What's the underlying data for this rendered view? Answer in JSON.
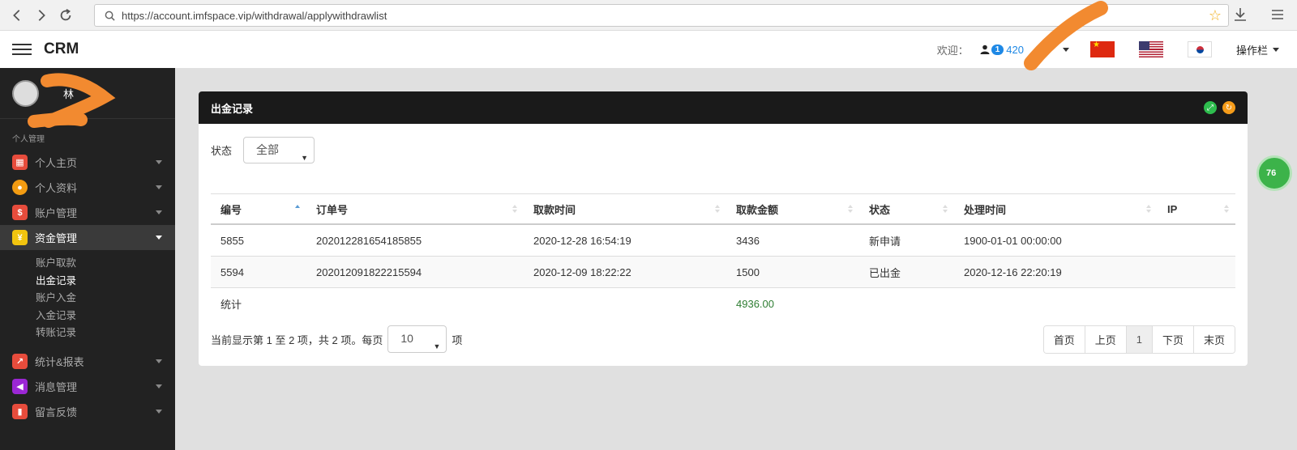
{
  "browser": {
    "url": "https://account.imfspace.vip/withdrawal/applywithdrawlist"
  },
  "header": {
    "brand": "CRM",
    "welcome": "欢迎：",
    "notify_count": "1",
    "user_id_partial": "420",
    "operations": "操作栏"
  },
  "sidebar": {
    "profile_name": "林",
    "section_label": "个人管理",
    "items": [
      {
        "label": "个人主页",
        "icon_color": "#e74c3c",
        "icon": "grid-icon"
      },
      {
        "label": "个人资料",
        "icon_color": "#f39c12",
        "icon": "person-icon"
      },
      {
        "label": "账户管理",
        "icon_color": "#e74c3c",
        "icon": "dollar-icon"
      },
      {
        "label": "资金管理",
        "icon_color": "#f1c40f",
        "icon": "yen-icon"
      },
      {
        "label": "统计&报表",
        "icon_color": "#e74c3c",
        "icon": "chart-icon"
      },
      {
        "label": "消息管理",
        "icon_color": "#9b27d4",
        "icon": "megaphone-icon"
      },
      {
        "label": "留言反馈",
        "icon_color": "#e74c3c",
        "icon": "feedback-icon"
      }
    ],
    "submenu": [
      "账户取款",
      "出金记录",
      "账户入金",
      "入金记录",
      "转账记录"
    ],
    "current_sub": "出金记录"
  },
  "panel": {
    "title": "出金记录",
    "filter_label": "状态",
    "filter_value": "全部"
  },
  "table": {
    "columns": [
      "编号",
      "订单号",
      "取款时间",
      "取款金额",
      "状态",
      "处理时间",
      "IP"
    ],
    "rows": [
      [
        "5855",
        "202012281654185855",
        "2020-12-28 16:54:19",
        "3436",
        "新申请",
        "1900-01-01 00:00:00",
        ""
      ],
      [
        "5594",
        "202012091822215594",
        "2020-12-09 18:22:22",
        "1500",
        "已出金",
        "2020-12-16 22:20:19",
        ""
      ]
    ],
    "total_label": "统计",
    "total_amount": "4936.00"
  },
  "footer": {
    "info_prefix": "当前显示第 1 至 2 项，共 2 项。每页",
    "page_size": "10",
    "info_suffix": "项",
    "pages": [
      "首页",
      "上页",
      "1",
      "下页",
      "末页"
    ]
  },
  "float_badge": "76"
}
